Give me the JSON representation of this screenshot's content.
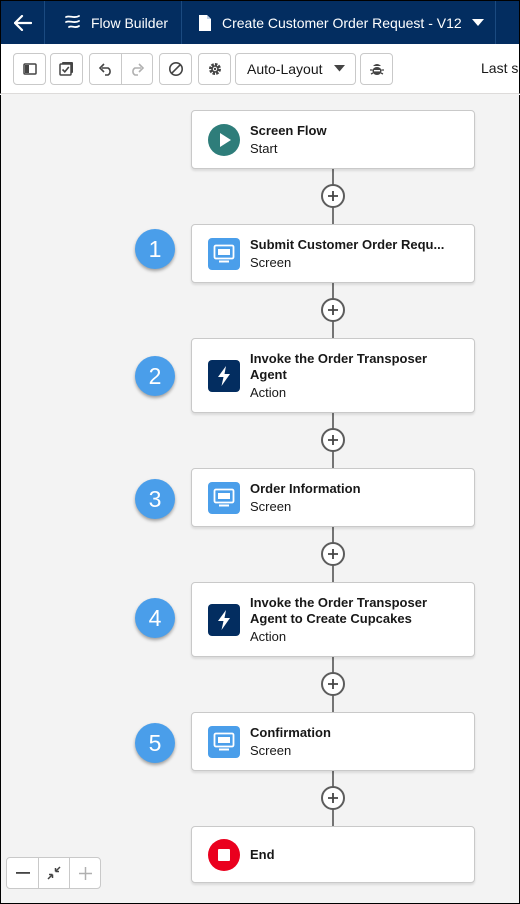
{
  "header": {
    "back_icon": "arrow-left-icon",
    "app_label": "Flow Builder",
    "flow_label": "Create Customer Order Request - V12"
  },
  "toolbar": {
    "layout_mode": "Auto-Layout",
    "last_saved_label": "Last sa"
  },
  "flow": {
    "start": {
      "title": "Screen Flow",
      "subtitle": "Start",
      "icon": "play-icon",
      "color": "#2e7d7a"
    },
    "steps": [
      {
        "number": "1",
        "title": "Submit Customer Order Requ...",
        "subtitle": "Screen",
        "icon": "screen-icon",
        "color": "#4a9eea"
      },
      {
        "number": "2",
        "title": "Invoke the Order Transposer Agent",
        "subtitle": "Action",
        "icon": "lightning-icon",
        "color": "#032d60"
      },
      {
        "number": "3",
        "title": "Order Information",
        "subtitle": "Screen",
        "icon": "screen-icon",
        "color": "#4a9eea"
      },
      {
        "number": "4",
        "title": "Invoke the Order Transposer Agent to Create Cupcakes",
        "subtitle": "Action",
        "icon": "lightning-icon",
        "color": "#032d60"
      },
      {
        "number": "5",
        "title": "Confirmation",
        "subtitle": "Screen",
        "icon": "screen-icon",
        "color": "#4a9eea"
      }
    ],
    "end": {
      "title": "End",
      "icon": "stop-icon",
      "color": "#ea001e"
    }
  }
}
